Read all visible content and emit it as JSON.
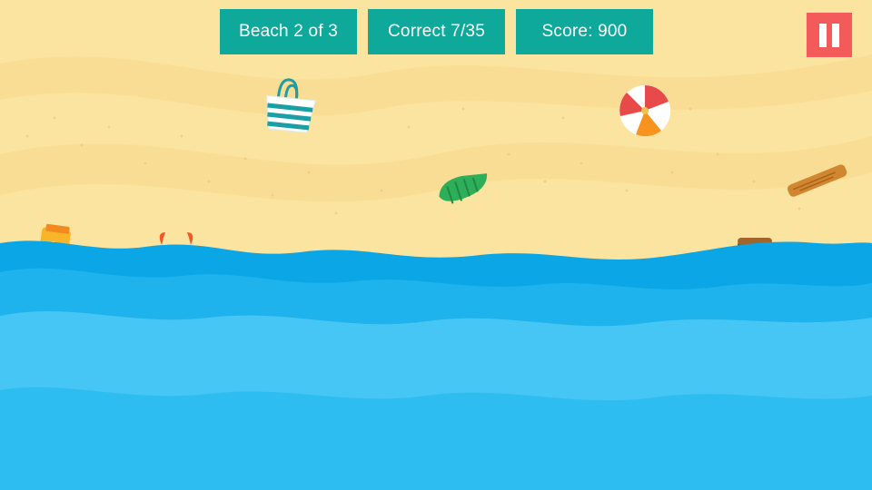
{
  "hud": {
    "beach": "Beach 2 of 3",
    "correct": "Correct 7/35",
    "score": "Score: 900"
  },
  "icons": {
    "pause": "pause-icon",
    "items": [
      "beach-bag-icon",
      "beach-ball-icon",
      "seashell-icon",
      "driftwood-icon",
      "sunscreen-icon",
      "crab-icon",
      "treasure-chest-icon"
    ]
  },
  "colors": {
    "sand": "#fbe3a0",
    "hud": "#0fa99c",
    "pause": "#f35b5b",
    "sea_dark": "#0aa6e6",
    "sea_mid": "#23b6ec",
    "sea_light": "#45c6f4"
  }
}
